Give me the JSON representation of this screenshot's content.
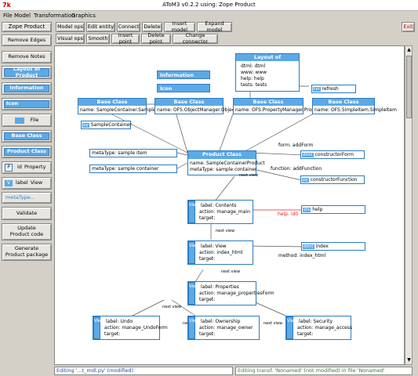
{
  "window": {
    "title": "AToM3 v0.2.2 using: Zope Product",
    "app_icon": "atom3-logo-icon"
  },
  "menu": [
    "File",
    "Model",
    "Transformation",
    "Graphics"
  ],
  "toolbar": {
    "panel": "Zope Product",
    "row1": [
      "Model ops",
      "Edit entity",
      "Connect",
      "Delete",
      "Insert model",
      "Expand model"
    ],
    "row2": [
      "Visual ops",
      "Smooth",
      "Insert point",
      "Delete point",
      "Change connector"
    ],
    "exit": "Exit"
  },
  "sidebar": {
    "remove_edges": "Remove Edges",
    "remove_notes": "Remove Notes",
    "layout": "Layout of Product",
    "information": "Information",
    "icon": "Icon",
    "file": "File",
    "base_class": "Base Class",
    "product_class": "Product Class",
    "property_p": "P",
    "property_id": "id",
    "property": "Property",
    "view_v": "V",
    "view_label": "label",
    "view": "View",
    "metatype": "metaType...",
    "validate": "Validate",
    "update": "Update\nProduct code",
    "generate": "Generate\nProduct package"
  },
  "diagram": {
    "layout_box": {
      "title": "Layout of SampleContainer",
      "rows": [
        "dtml: dtml",
        "www: www",
        "help: help",
        "tests: tests"
      ]
    },
    "information": "Information",
    "icon": "Icon",
    "refresh_tag": "txt",
    "refresh": "refresh",
    "base_classes": [
      {
        "title": "Base Class",
        "name": "name: SampleContainer.SampleCo"
      },
      {
        "title": "Base Class",
        "name": "name: OFS.ObjectManager.ObjectM"
      },
      {
        "title": "Base Class",
        "name": "name: OFS.PropertyManager.Prope"
      },
      {
        "title": "Base Class",
        "name": "name: OFS.SimpleItem.SimpleItem"
      }
    ],
    "py_tag": "py",
    "py_file": "SampleContainer",
    "meta1": "metaType: sample item",
    "meta2": "metaType: sample container",
    "product": {
      "title": "Product Class",
      "name": "name: SampleContainerProduct",
      "meta": "metaType: sample container"
    },
    "form_label": "form: addForm",
    "function_label": "function: addFunction",
    "constructorForm_tag": "dtml",
    "constructorForm": "constructorForm",
    "constructorFunction_tag": "py",
    "constructorFunction": "constructorFunction",
    "next_view": "next view",
    "help_label": "help: id0",
    "help_tag": "stx",
    "help": "help",
    "index_tag": "dtml",
    "index": "index",
    "method_label": "method: index_html",
    "views": [
      {
        "label": "label: Contents",
        "action": "action: manage_main",
        "target": "target:"
      },
      {
        "label": "label: View",
        "action": "action: index_html",
        "target": "target:"
      },
      {
        "label": "label: Properties",
        "action": "action: manage_propertiesForm",
        "target": "target:"
      },
      {
        "label": "label: Undo",
        "action": "action: manage_UndoForm",
        "target": "target:"
      },
      {
        "label": "label: Ownership",
        "action": "action: manage_owner",
        "target": "target:"
      },
      {
        "label": "label: Security",
        "action": "action: manage_access",
        "target": "target:"
      }
    ],
    "view_text": "View"
  },
  "status": {
    "left": "Editing '...t_mdl.py' (modified)",
    "right": "Editing transf. 'Nonamed' (not modified) in file 'Nonamed'"
  },
  "colors": {
    "accent": "#5ba9e6",
    "help_edge": "#e02020"
  }
}
